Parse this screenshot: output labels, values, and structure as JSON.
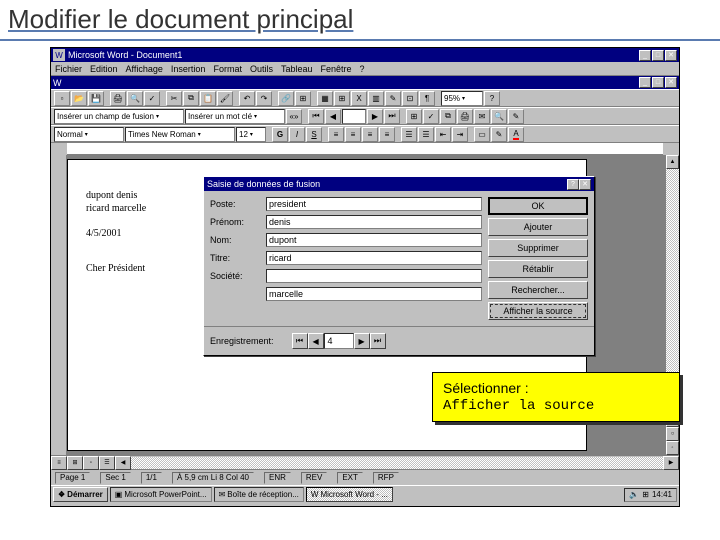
{
  "slide": {
    "title": "Modifier le document principal"
  },
  "app": {
    "title": "Microsoft Word - Document1",
    "menus": [
      "Fichier",
      "Edition",
      "Affichage",
      "Insertion",
      "Format",
      "Outils",
      "Tableau",
      "Fenêtre",
      "?"
    ],
    "zoom": "95%"
  },
  "toolbar2": {
    "merge_insert": "Insérer un champ de fusion",
    "word_insert": "Insérer un mot clé"
  },
  "format_bar": {
    "style": "Normal",
    "font": "Times New Roman",
    "size": "12"
  },
  "doc": {
    "line1": "dupont denis",
    "line2": "ricard marcelle",
    "line3": "",
    "date": "4/5/2001",
    "salutation": "Cher Président"
  },
  "dialog": {
    "title": "Saisie de données de fusion",
    "help": "?",
    "close": "✕",
    "fields": {
      "poste_label": "Poste:",
      "poste_value": "president",
      "prenom_label": "Prénom:",
      "prenom_value": "denis",
      "nom_label": "Nom:",
      "nom_value": "dupont",
      "titre_label": "Titre:",
      "titre_value": "ricard",
      "societe_label": "Société:",
      "societe_value": "",
      "adr_label": "",
      "adr_value": "marcelle"
    },
    "buttons": {
      "ok": "OK",
      "ajouter": "Ajouter",
      "supprimer": "Supprimer",
      "retablir": "Rétablir",
      "rechercher": "Rechercher...",
      "afficher": "Afficher la source"
    },
    "nav": {
      "label": "Enregistrement:",
      "value": "4"
    }
  },
  "status": {
    "page": "Page 1",
    "sec": "Sec 1",
    "pages": "1/1",
    "pos": "À 5,9 cm  Li 8  Col 40",
    "modes": [
      "ENR",
      "REV",
      "EXT",
      "RFP"
    ]
  },
  "taskbar": {
    "start": "Démarrer",
    "items": [
      "Microsoft PowerPoint...",
      "Boîte de réception...",
      "Microsoft Word - ..."
    ],
    "clock": "14:41"
  },
  "callout": {
    "line1": "Sélectionner :",
    "line2": "Afficher la source"
  }
}
